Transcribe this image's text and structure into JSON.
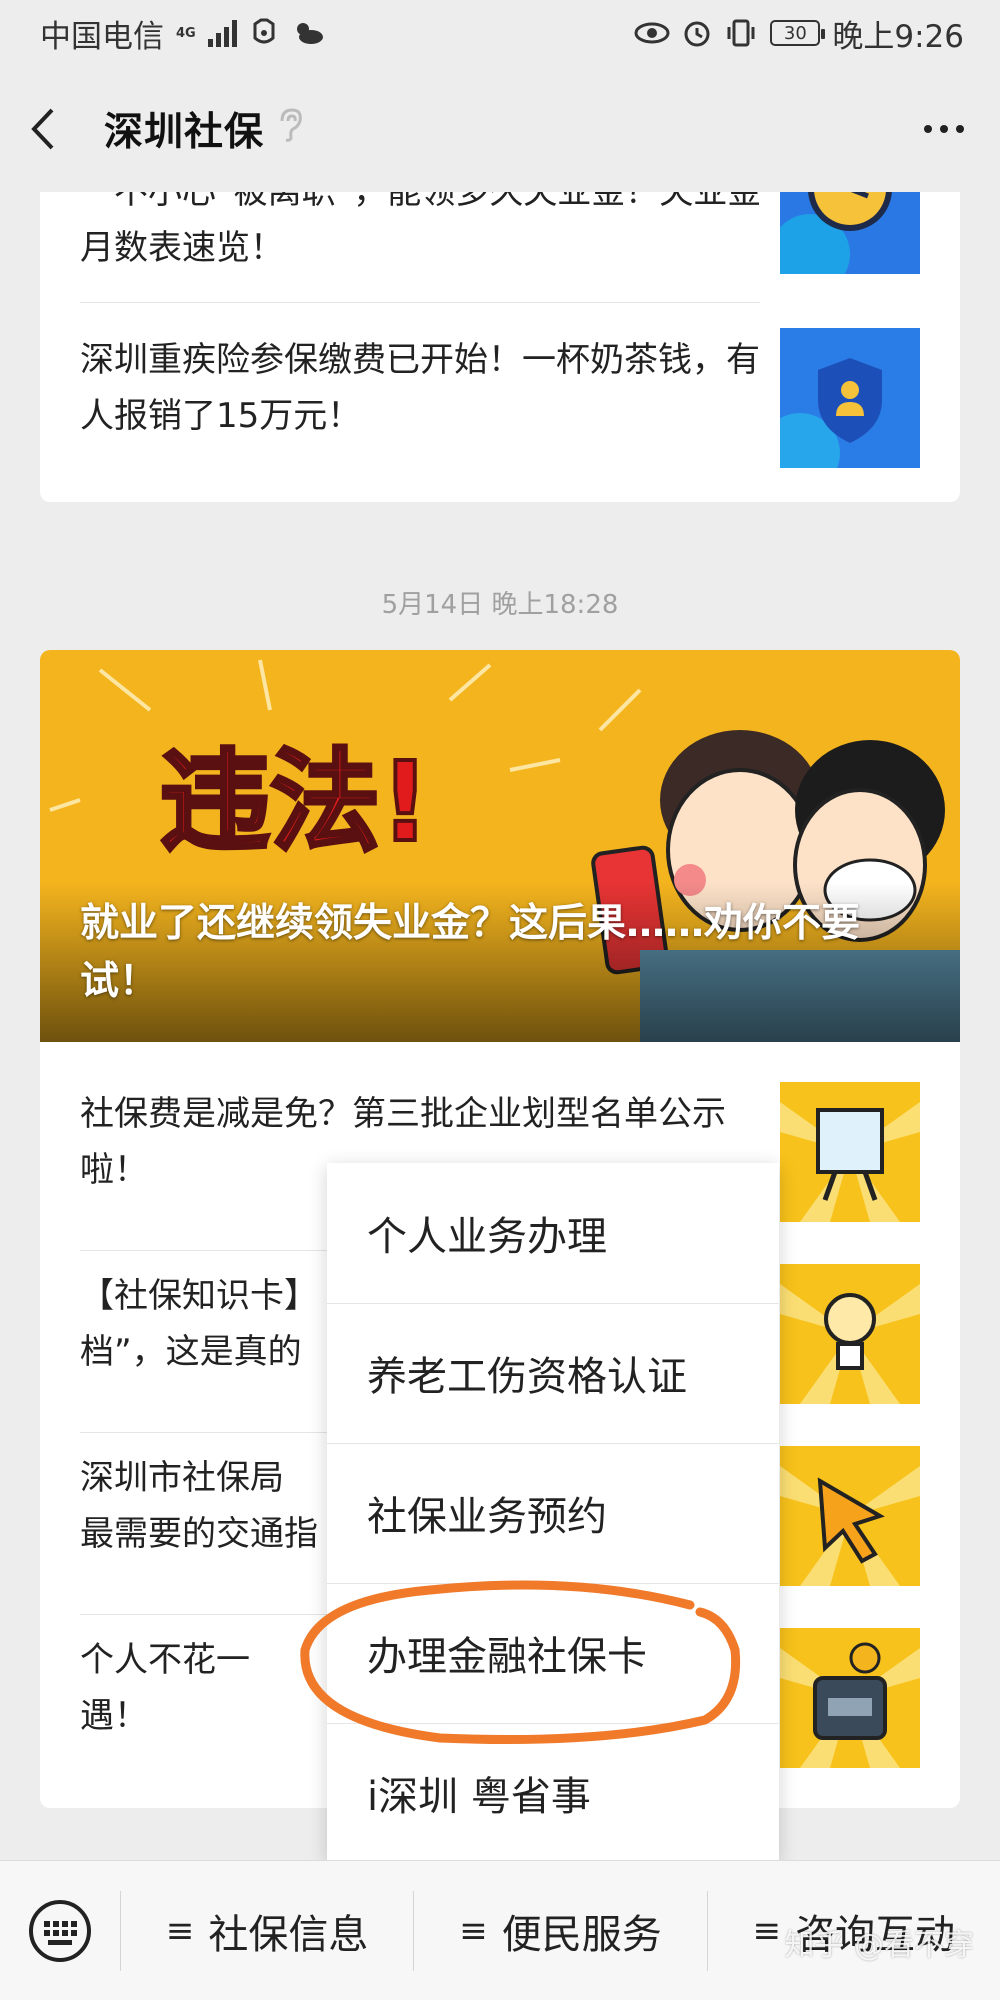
{
  "status_bar": {
    "carrier": "中国电信",
    "network": "4G",
    "battery": "30",
    "time": "晚上9:26"
  },
  "nav": {
    "title": "深圳社保"
  },
  "top_articles": [
    {
      "title": "一不小心“被离职”，能领多久失业金？失业金月数表速览！",
      "icon": "clock-icon"
    },
    {
      "title": "深圳重疾险参保缴费已开始！一杯奶茶钱，有人报销了15万元！",
      "icon": "shield-user-icon"
    }
  ],
  "timestamp": "5月14日 晚上18:28",
  "banner": {
    "overlay_text": "违法!",
    "title": "就业了还继续领失业金？这后果……劝你不要试！"
  },
  "articles": [
    {
      "title": "社保费是减是免？第三批企业划型名单公示啦！",
      "icon": "flipchart-icon"
    },
    {
      "title": "【社保知识卡】",
      "line2": "档”，这是真的",
      "icon": "lightbulb-icon"
    },
    {
      "title": "深圳市社保局",
      "line2": "最需要的交通指",
      "icon": "cursor-icon"
    },
    {
      "title": "个人不花一",
      "line2": "遇！",
      "icon": "card-reader-icon"
    }
  ],
  "popup_menu": [
    {
      "label": "个人业务办理"
    },
    {
      "label": "养老工伤资格认证"
    },
    {
      "label": "社保业务预约"
    },
    {
      "label": "办理金融社保卡",
      "highlighted": true
    },
    {
      "label": "i深圳 粤省事"
    }
  ],
  "bottom_menu": [
    {
      "label": "社保信息"
    },
    {
      "label": "便民服务"
    },
    {
      "label": "咨询互动"
    }
  ],
  "watermark": "知乎 @看不穿",
  "colors": {
    "highlight": "#f07a2a",
    "banner_bg": "#f4b41e",
    "thumb_bg": "#f7c21b",
    "thumb_blue": "#2a78e4"
  }
}
